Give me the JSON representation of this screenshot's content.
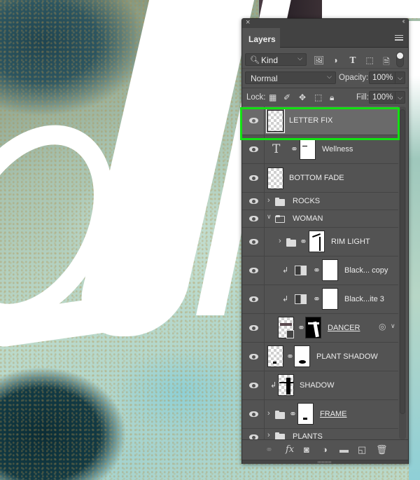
{
  "panel": {
    "close_icon": "×",
    "collapse_icon": "‹‹",
    "tab_label": "Layers",
    "filter": {
      "kind_label": "Kind",
      "icons": [
        "image-filter-icon",
        "adjustment-filter-icon",
        "type-filter-icon",
        "shape-filter-icon",
        "smart-object-filter-icon"
      ]
    },
    "blend_mode": "Normal",
    "opacity_label": "Opacity:",
    "opacity_value": "100%",
    "lock_label": "Lock:",
    "fill_label": "Fill:",
    "fill_value": "100%"
  },
  "layers": [
    {
      "name": "LETTER FIX",
      "type": "pixel",
      "selected": true,
      "visible": true
    },
    {
      "name": "Wellness",
      "type": "text",
      "visible": true,
      "has_mask": true
    },
    {
      "name": "BOTTOM FADE",
      "type": "pixel",
      "visible": true
    },
    {
      "name": "ROCKS",
      "type": "group",
      "expanded": false,
      "visible": true
    },
    {
      "name": "WOMAN",
      "type": "group",
      "expanded": true,
      "visible": true
    },
    {
      "name": "RIM LIGHT",
      "type": "group",
      "expanded": false,
      "visible": true,
      "has_mask": true,
      "indent": 1
    },
    {
      "name": "Black... copy",
      "type": "adjustment",
      "clipped": true,
      "visible": true,
      "has_mask": true,
      "indent": 1
    },
    {
      "name": "Black...ite 3",
      "type": "adjustment",
      "clipped": true,
      "visible": true,
      "has_mask": true,
      "indent": 1
    },
    {
      "name": "DANCER",
      "type": "smart-object",
      "visible": true,
      "has_mask": true,
      "underlined": true,
      "has_effects": true,
      "indent": 1
    },
    {
      "name": "PLANT SHADOW",
      "type": "pixel",
      "visible": true,
      "has_mask": true
    },
    {
      "name": "SHADOW",
      "type": "pixel",
      "clipped": true,
      "visible": true
    },
    {
      "name": "FRAME",
      "type": "group",
      "expanded": false,
      "visible": true,
      "has_mask": true,
      "underlined": true
    },
    {
      "name": "PLANTS",
      "type": "group",
      "expanded": false,
      "visible": true
    }
  ],
  "bottom_bar": {
    "icons": [
      "link-layers-icon",
      "fx-icon",
      "add-mask-icon",
      "new-adjustment-icon",
      "new-group-icon",
      "new-layer-icon",
      "delete-icon"
    ],
    "fx_label": "fx"
  },
  "colors": {
    "panel_bg": "#535353",
    "selection_highlight": "#12e012"
  }
}
